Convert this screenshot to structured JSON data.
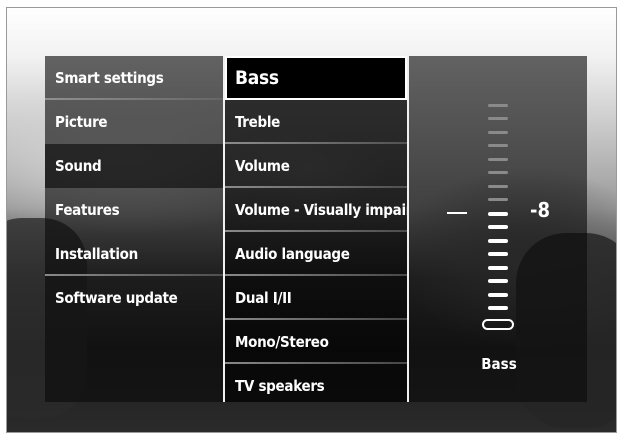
{
  "menu": {
    "left_items": [
      {
        "label": "Smart settings"
      },
      {
        "label": "Picture"
      },
      {
        "label": "Sound"
      },
      {
        "label": "Features"
      },
      {
        "label": "Installation"
      },
      {
        "label": "Software update"
      }
    ],
    "active_left": "Sound",
    "sound_items": [
      {
        "label": "Bass"
      },
      {
        "label": "Treble"
      },
      {
        "label": "Volume"
      },
      {
        "label": "Volume - Visually impair"
      },
      {
        "label": "Audio language"
      },
      {
        "label": "Dual I/II"
      },
      {
        "label": "Mono/Stereo"
      },
      {
        "label": "TV speakers"
      }
    ],
    "selected_item": "Bass"
  },
  "slider": {
    "label": "Bass",
    "value": "-8",
    "value_numeric": -8,
    "tick_count": 16,
    "active_ticks": 8
  }
}
